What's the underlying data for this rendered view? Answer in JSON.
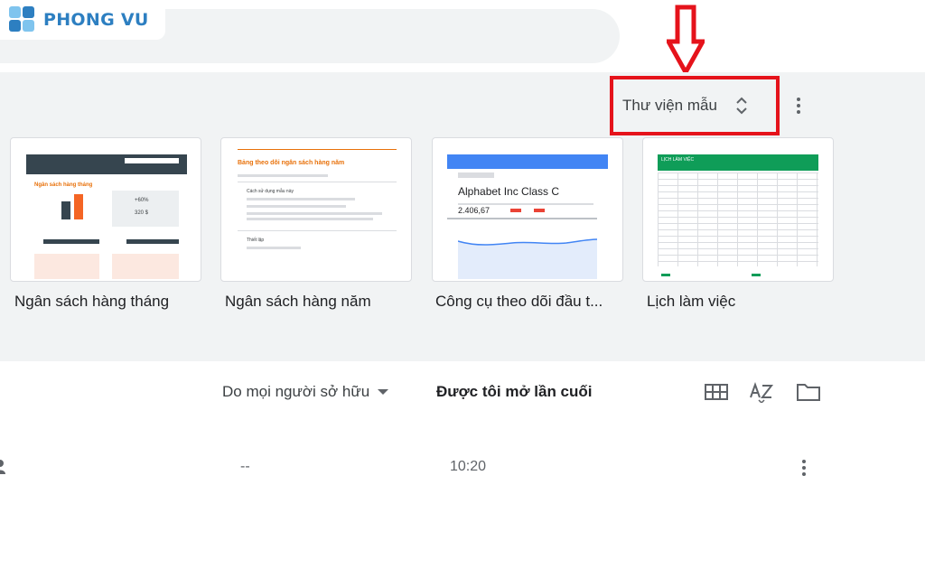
{
  "brand": {
    "name": "PHONG VU"
  },
  "gallery": {
    "toggle_label": "Thư viện mẫu",
    "templates": [
      {
        "title": "Ngân sách hàng tháng",
        "thumb_heading": "Ngân sách hàng tháng",
        "thumb_stat": "+60%",
        "thumb_sub": "320 $"
      },
      {
        "title": "Ngân sách hàng năm",
        "thumb_heading": "Bảng theo dõi ngân sách hàng năm",
        "thumb_section": "Cách sử dụng mẫu này",
        "thumb_foot": "Thiết lập"
      },
      {
        "title": "Công cụ theo dõi đầu t...",
        "thumb_heading": "Alphabet Inc Class C",
        "thumb_value": "2.406,67"
      },
      {
        "title": "Lịch làm việc",
        "thumb_heading": "LỊCH LÀM VIỆC"
      }
    ]
  },
  "list_header": {
    "owner_filter": "Do mọi người sở hữu",
    "sort_label": "Được tôi mở lần cuối"
  },
  "files": [
    {
      "owner": "--",
      "opened": "10:20"
    }
  ],
  "icons": {
    "view_toggle": "grid-icon",
    "sort": "sort-az-icon",
    "picker": "folder-icon",
    "gallery_toggle": "unfold-more-icon",
    "more": "more-vert-icon",
    "shared": "people-icon"
  },
  "colors": {
    "highlight": "#e5131b",
    "brand": "#2d7fc1",
    "sheets_green": "#0f9d58"
  }
}
